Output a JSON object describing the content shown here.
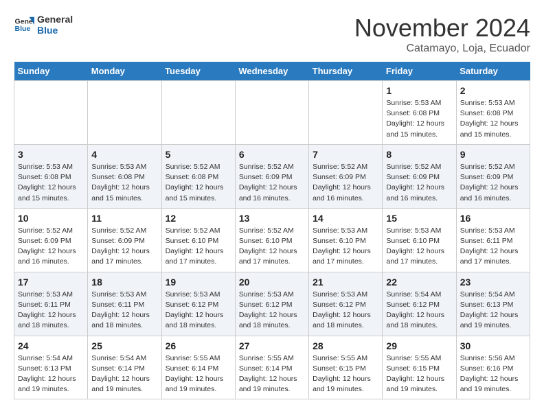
{
  "header": {
    "logo_line1": "General",
    "logo_line2": "Blue",
    "month_year": "November 2024",
    "location": "Catamayo, Loja, Ecuador"
  },
  "weekdays": [
    "Sunday",
    "Monday",
    "Tuesday",
    "Wednesday",
    "Thursday",
    "Friday",
    "Saturday"
  ],
  "weeks": [
    [
      {
        "day": "",
        "info": ""
      },
      {
        "day": "",
        "info": ""
      },
      {
        "day": "",
        "info": ""
      },
      {
        "day": "",
        "info": ""
      },
      {
        "day": "",
        "info": ""
      },
      {
        "day": "1",
        "info": "Sunrise: 5:53 AM\nSunset: 6:08 PM\nDaylight: 12 hours\nand 15 minutes."
      },
      {
        "day": "2",
        "info": "Sunrise: 5:53 AM\nSunset: 6:08 PM\nDaylight: 12 hours\nand 15 minutes."
      }
    ],
    [
      {
        "day": "3",
        "info": "Sunrise: 5:53 AM\nSunset: 6:08 PM\nDaylight: 12 hours\nand 15 minutes."
      },
      {
        "day": "4",
        "info": "Sunrise: 5:53 AM\nSunset: 6:08 PM\nDaylight: 12 hours\nand 15 minutes."
      },
      {
        "day": "5",
        "info": "Sunrise: 5:52 AM\nSunset: 6:08 PM\nDaylight: 12 hours\nand 15 minutes."
      },
      {
        "day": "6",
        "info": "Sunrise: 5:52 AM\nSunset: 6:09 PM\nDaylight: 12 hours\nand 16 minutes."
      },
      {
        "day": "7",
        "info": "Sunrise: 5:52 AM\nSunset: 6:09 PM\nDaylight: 12 hours\nand 16 minutes."
      },
      {
        "day": "8",
        "info": "Sunrise: 5:52 AM\nSunset: 6:09 PM\nDaylight: 12 hours\nand 16 minutes."
      },
      {
        "day": "9",
        "info": "Sunrise: 5:52 AM\nSunset: 6:09 PM\nDaylight: 12 hours\nand 16 minutes."
      }
    ],
    [
      {
        "day": "10",
        "info": "Sunrise: 5:52 AM\nSunset: 6:09 PM\nDaylight: 12 hours\nand 16 minutes."
      },
      {
        "day": "11",
        "info": "Sunrise: 5:52 AM\nSunset: 6:09 PM\nDaylight: 12 hours\nand 17 minutes."
      },
      {
        "day": "12",
        "info": "Sunrise: 5:52 AM\nSunset: 6:10 PM\nDaylight: 12 hours\nand 17 minutes."
      },
      {
        "day": "13",
        "info": "Sunrise: 5:52 AM\nSunset: 6:10 PM\nDaylight: 12 hours\nand 17 minutes."
      },
      {
        "day": "14",
        "info": "Sunrise: 5:53 AM\nSunset: 6:10 PM\nDaylight: 12 hours\nand 17 minutes."
      },
      {
        "day": "15",
        "info": "Sunrise: 5:53 AM\nSunset: 6:10 PM\nDaylight: 12 hours\nand 17 minutes."
      },
      {
        "day": "16",
        "info": "Sunrise: 5:53 AM\nSunset: 6:11 PM\nDaylight: 12 hours\nand 17 minutes."
      }
    ],
    [
      {
        "day": "17",
        "info": "Sunrise: 5:53 AM\nSunset: 6:11 PM\nDaylight: 12 hours\nand 18 minutes."
      },
      {
        "day": "18",
        "info": "Sunrise: 5:53 AM\nSunset: 6:11 PM\nDaylight: 12 hours\nand 18 minutes."
      },
      {
        "day": "19",
        "info": "Sunrise: 5:53 AM\nSunset: 6:12 PM\nDaylight: 12 hours\nand 18 minutes."
      },
      {
        "day": "20",
        "info": "Sunrise: 5:53 AM\nSunset: 6:12 PM\nDaylight: 12 hours\nand 18 minutes."
      },
      {
        "day": "21",
        "info": "Sunrise: 5:53 AM\nSunset: 6:12 PM\nDaylight: 12 hours\nand 18 minutes."
      },
      {
        "day": "22",
        "info": "Sunrise: 5:54 AM\nSunset: 6:12 PM\nDaylight: 12 hours\nand 18 minutes."
      },
      {
        "day": "23",
        "info": "Sunrise: 5:54 AM\nSunset: 6:13 PM\nDaylight: 12 hours\nand 19 minutes."
      }
    ],
    [
      {
        "day": "24",
        "info": "Sunrise: 5:54 AM\nSunset: 6:13 PM\nDaylight: 12 hours\nand 19 minutes."
      },
      {
        "day": "25",
        "info": "Sunrise: 5:54 AM\nSunset: 6:14 PM\nDaylight: 12 hours\nand 19 minutes."
      },
      {
        "day": "26",
        "info": "Sunrise: 5:55 AM\nSunset: 6:14 PM\nDaylight: 12 hours\nand 19 minutes."
      },
      {
        "day": "27",
        "info": "Sunrise: 5:55 AM\nSunset: 6:14 PM\nDaylight: 12 hours\nand 19 minutes."
      },
      {
        "day": "28",
        "info": "Sunrise: 5:55 AM\nSunset: 6:15 PM\nDaylight: 12 hours\nand 19 minutes."
      },
      {
        "day": "29",
        "info": "Sunrise: 5:55 AM\nSunset: 6:15 PM\nDaylight: 12 hours\nand 19 minutes."
      },
      {
        "day": "30",
        "info": "Sunrise: 5:56 AM\nSunset: 6:16 PM\nDaylight: 12 hours\nand 19 minutes."
      }
    ]
  ]
}
